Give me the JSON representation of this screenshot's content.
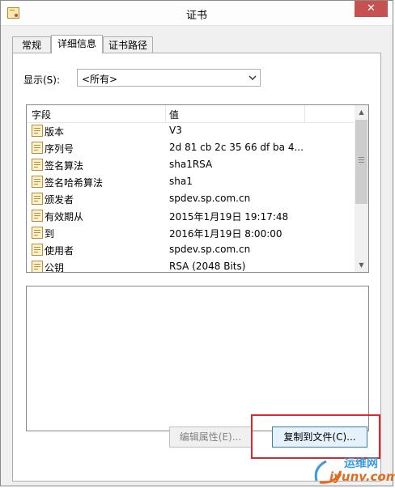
{
  "window": {
    "title": "证书",
    "close_glyph": "✕"
  },
  "tabs": [
    {
      "label": "常规",
      "active": false
    },
    {
      "label": "详细信息",
      "active": true
    },
    {
      "label": "证书路径",
      "active": false
    }
  ],
  "show": {
    "label": "显示(S):",
    "value": "<所有>"
  },
  "list": {
    "columns": [
      "字段",
      "值"
    ],
    "rows": [
      {
        "field": "版本",
        "value": "V3"
      },
      {
        "field": "序列号",
        "value": "2d 81 cb 2c 35 66 df ba 4..."
      },
      {
        "field": "签名算法",
        "value": "sha1RSA"
      },
      {
        "field": "签名哈希算法",
        "value": "sha1"
      },
      {
        "field": "颁发者",
        "value": "spdev.sp.com.cn"
      },
      {
        "field": "有效期从",
        "value": "2015年1月19日 19:17:48"
      },
      {
        "field": "到",
        "value": "2016年1月19日 8:00:00"
      },
      {
        "field": "使用者",
        "value": "spdev.sp.com.cn"
      },
      {
        "field": "公钥",
        "value": "RSA (2048 Bits)"
      }
    ],
    "scroll_up": "▲",
    "scroll_down": "▼"
  },
  "buttons": {
    "edit_properties": "编辑属性(E)...",
    "copy_to_file": "复制到文件(C)..."
  },
  "watermark": {
    "cn": "运维网",
    "en": "iyunv.com"
  },
  "colors": {
    "highlight_box": "#e3242b",
    "close_button": "#c75050"
  }
}
